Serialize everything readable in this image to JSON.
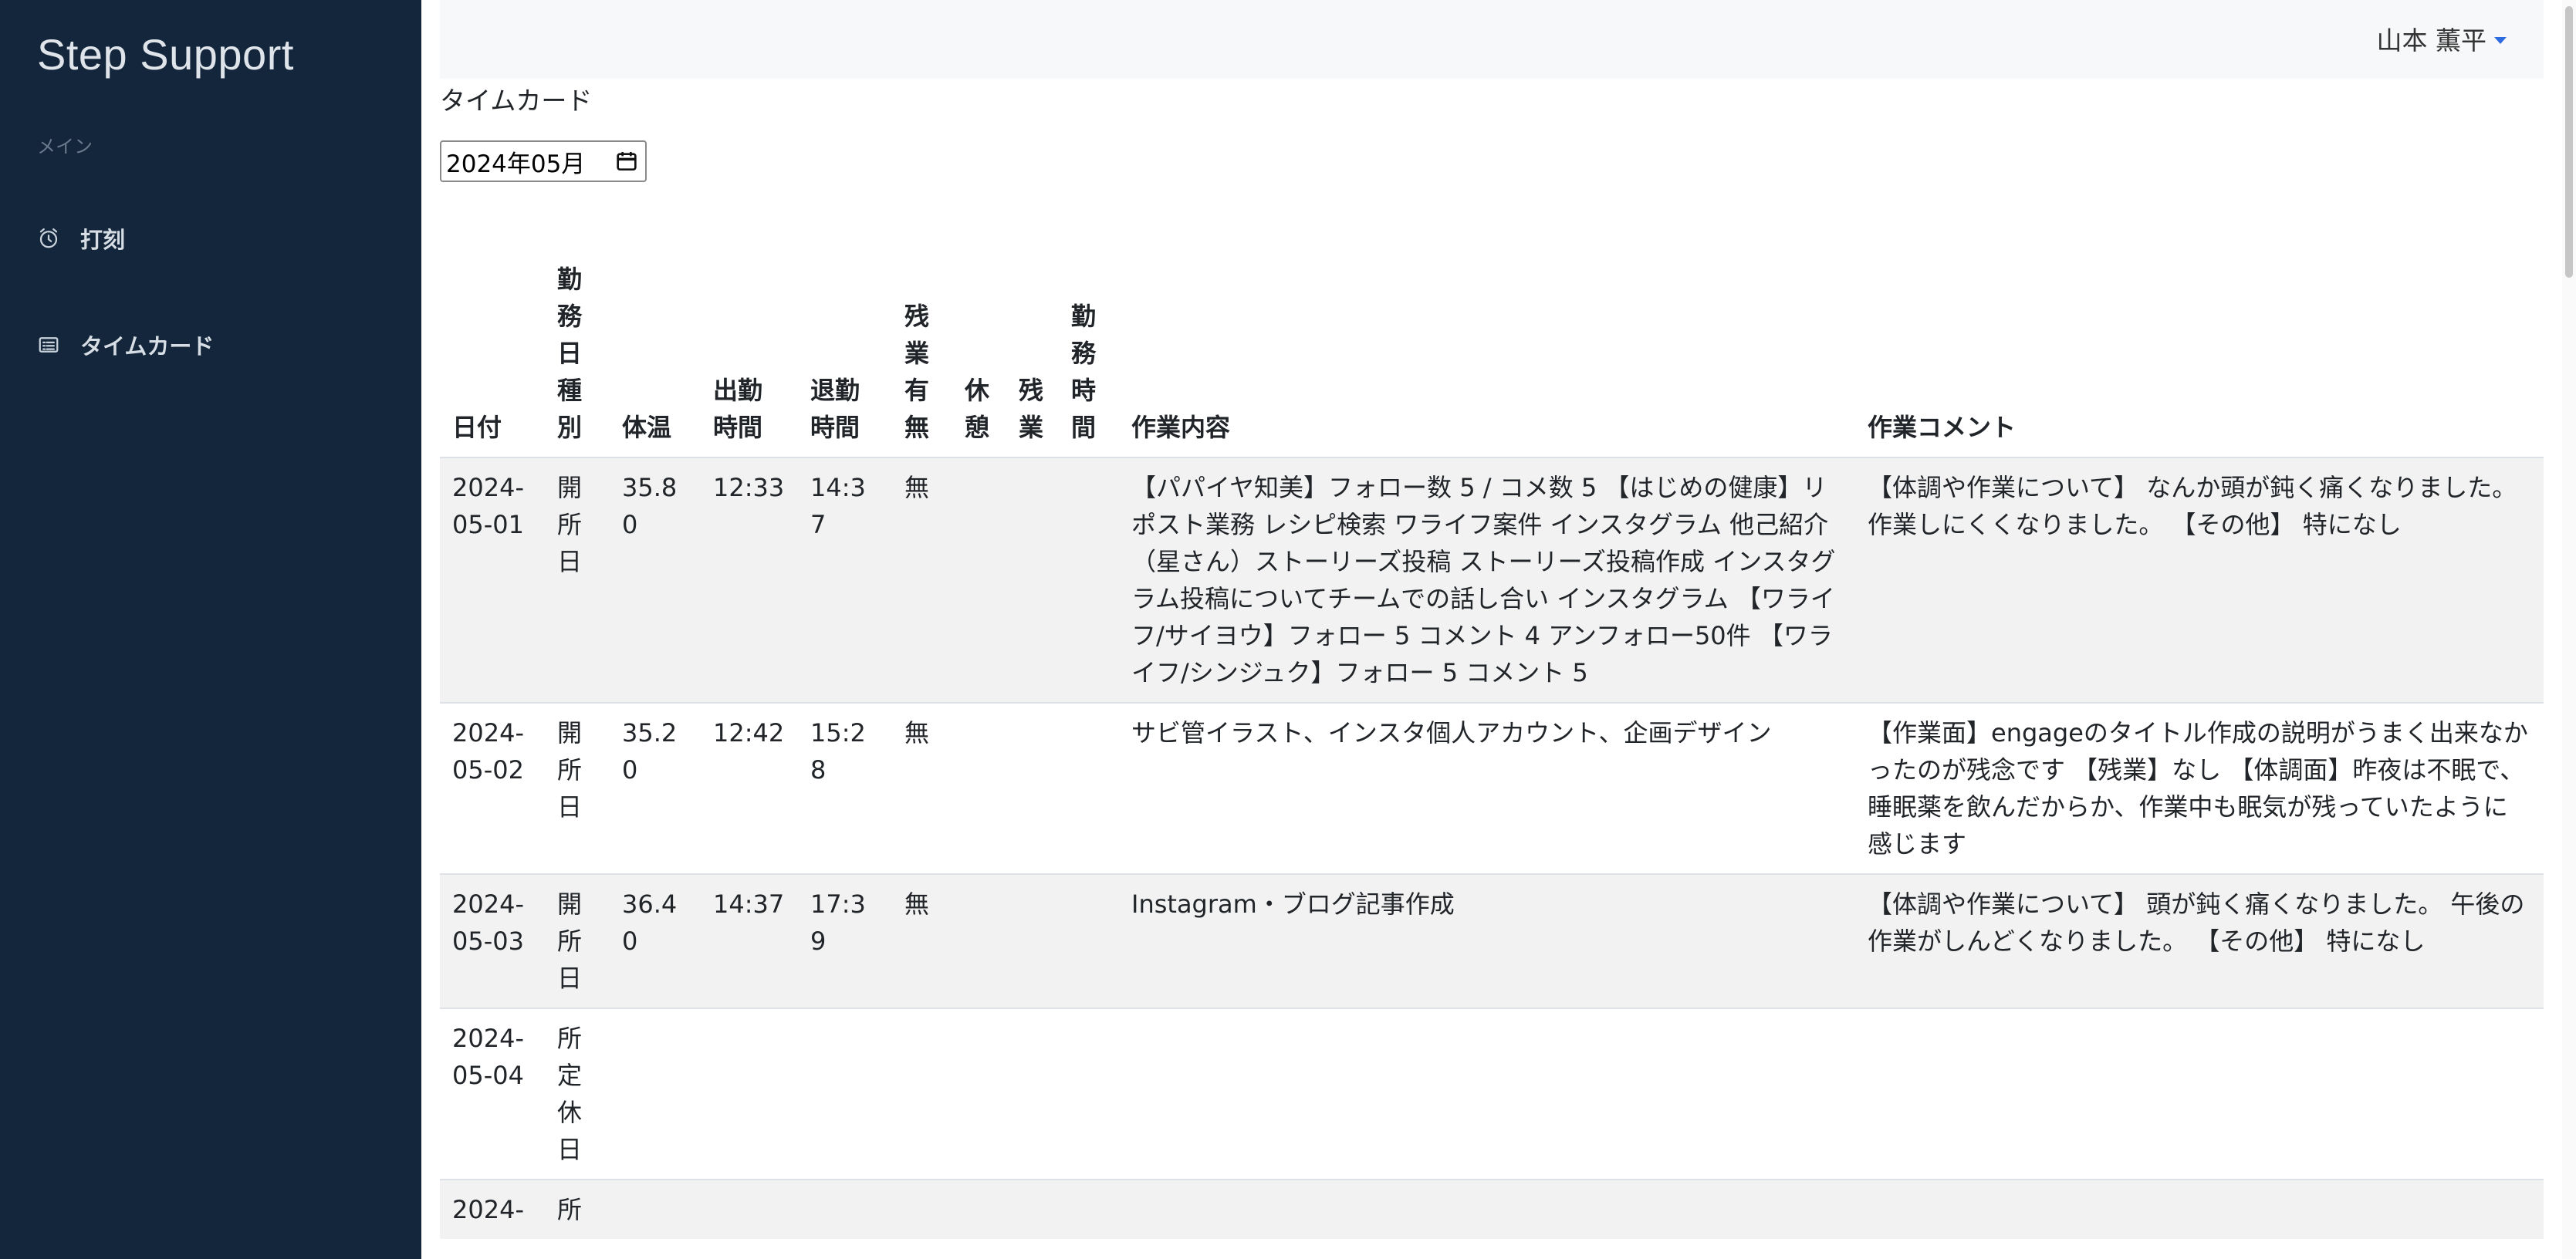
{
  "app": {
    "brand": "Step Support"
  },
  "sidebar": {
    "section_label": "メイン",
    "items": [
      {
        "label": "打刻",
        "icon": "alarm-clock-icon"
      },
      {
        "label": "タイムカード",
        "icon": "timecard-list-icon"
      }
    ]
  },
  "header": {
    "user_name": "山本 薫平"
  },
  "page": {
    "title": "タイムカード",
    "month_value": "2024年05月"
  },
  "table": {
    "headers": [
      "日付",
      "勤務日種別",
      "体温",
      "出勤時間",
      "退勤時間",
      "残業有無",
      "休憩",
      "残業",
      "勤務時間",
      "作業内容",
      "作業コメント"
    ],
    "rows": [
      {
        "date": "2024-05-01",
        "type": "開所日",
        "temp": "35.80",
        "in": "12:33",
        "out": "14:37",
        "ot_flag": "無",
        "break": "",
        "ot": "",
        "hours": "",
        "work": "【パパイヤ知美】フォロー数 5 / コメ数 5 【はじめの健康】リポスト業務 レシピ検索 ワライフ案件 インスタグラム 他己紹介（星さん）ストーリーズ投稿 ストーリーズ投稿作成 インスタグラム投稿についてチームでの話し合い インスタグラム 【ワライフ/サイヨウ】フォロー 5 コメント 4 アンフォロー50件 【ワライフ/シンジュク】フォロー 5 コメント 5",
        "comment": "【体調や作業について】 なんか頭が鈍く痛くなりました。 作業しにくくなりました。 【その他】 特になし"
      },
      {
        "date": "2024-05-02",
        "type": "開所日",
        "temp": "35.20",
        "in": "12:42",
        "out": "15:28",
        "ot_flag": "無",
        "break": "",
        "ot": "",
        "hours": "",
        "work": "サビ管イラスト、インスタ個人アカウント、企画デザイン",
        "comment": "【作業面】engageのタイトル作成の説明がうまく出来なかったのが残念です 【残業】なし 【体調面】昨夜は不眠で、睡眠薬を飲んだからか、作業中も眠気が残っていたように感じます"
      },
      {
        "date": "2024-05-03",
        "type": "開所日",
        "temp": "36.40",
        "in": "14:37",
        "out": "17:39",
        "ot_flag": "無",
        "break": "",
        "ot": "",
        "hours": "",
        "work": "Instagram・ブログ記事作成",
        "comment": "【体調や作業について】 頭が鈍く痛くなりました。 午後の作業がしんどくなりました。 【その他】 特になし"
      },
      {
        "date": "2024-05-04",
        "type": "所定休日",
        "temp": "",
        "in": "",
        "out": "",
        "ot_flag": "",
        "break": "",
        "ot": "",
        "hours": "",
        "work": "",
        "comment": ""
      },
      {
        "date": "2024-",
        "type": "所",
        "temp": "",
        "in": "",
        "out": "",
        "ot_flag": "",
        "break": "",
        "ot": "",
        "hours": "",
        "work": "",
        "comment": ""
      }
    ]
  }
}
